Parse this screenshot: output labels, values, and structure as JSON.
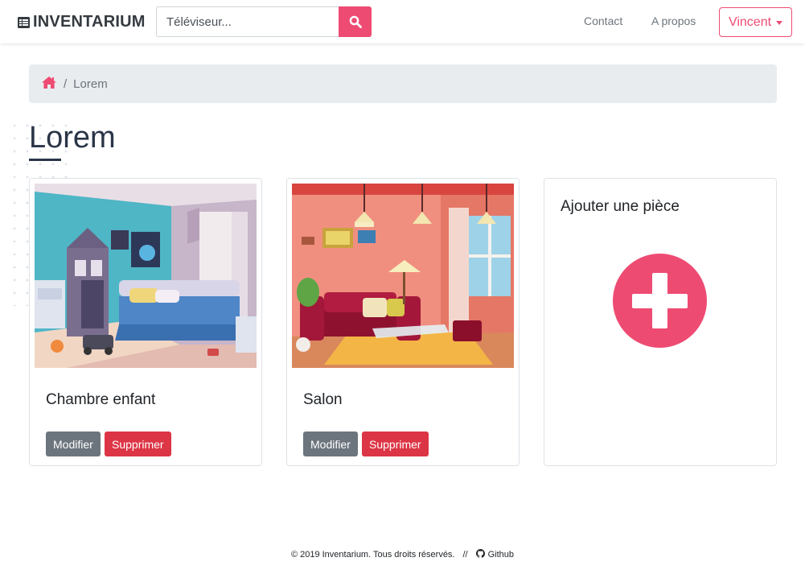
{
  "navbar": {
    "brand": "INVENTARIUM",
    "search_placeholder": "Téléviseur...",
    "links": {
      "contact": "Contact",
      "about": "A propos"
    },
    "user": "Vincent"
  },
  "breadcrumb": {
    "separator": "/",
    "current": "Lorem"
  },
  "page": {
    "title": "Lorem"
  },
  "rooms": [
    {
      "name": "Chambre enfant",
      "edit_label": "Modifier",
      "delete_label": "Supprimer"
    },
    {
      "name": "Salon",
      "edit_label": "Modifier",
      "delete_label": "Supprimer"
    }
  ],
  "add_card": {
    "title": "Ajouter une pièce"
  },
  "footer": {
    "copyright": "© 2019 Inventarium. Tous droits réservés.",
    "separator": "//",
    "github": "Github"
  },
  "colors": {
    "accent": "#ee4b73",
    "secondary": "#6c757d",
    "danger": "#dc3545",
    "title": "#2a3547"
  }
}
